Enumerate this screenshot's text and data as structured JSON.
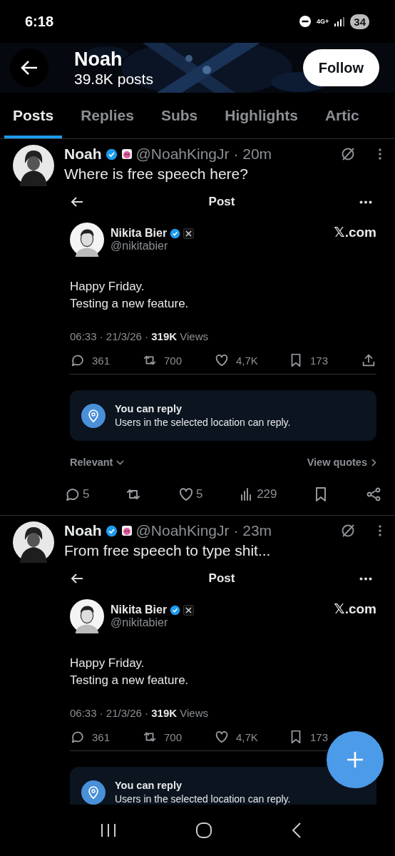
{
  "status_bar": {
    "time": "6:18",
    "network": "4G+",
    "battery": "34"
  },
  "header": {
    "name": "Noah",
    "posts_count": "39.8K posts",
    "follow_button": "Follow"
  },
  "tabs": [
    {
      "label": "Posts",
      "selected": true
    },
    {
      "label": "Replies",
      "selected": false
    },
    {
      "label": "Subs",
      "selected": false
    },
    {
      "label": "Highlights",
      "selected": false
    },
    {
      "label": "Artic",
      "selected": false
    }
  ],
  "posts": [
    {
      "name": "Noah",
      "meta": "@NoahKingJr · 20m",
      "text": "Where is free speech here?",
      "embed": {
        "title": "Post",
        "author": "Nikita Bier",
        "handle": "@nikitabier",
        "site": "𝕏.com",
        "body": "Happy Friday.\nTesting a new feature.",
        "meta": "06:33 · 21/3/26 · **319K** Views",
        "stats": [
          {
            "kind": "reply",
            "count": "361"
          },
          {
            "kind": "repost",
            "count": "700"
          },
          {
            "kind": "like",
            "count": "4,7K"
          },
          {
            "kind": "bookmark",
            "count": "173"
          },
          {
            "kind": "upload"
          }
        ],
        "notice": {
          "title": "You can reply",
          "text": "Users in the selected location can reply."
        },
        "sort": "Relevant",
        "quotes": "View quotes"
      },
      "actions": [
        {
          "kind": "reply",
          "count": "5"
        },
        {
          "kind": "repost"
        },
        {
          "kind": "like",
          "count": "5"
        },
        {
          "kind": "views",
          "count": "229"
        },
        {
          "kind": "bookmark"
        },
        {
          "kind": "share"
        }
      ]
    },
    {
      "name": "Noah",
      "meta": "@NoahKingJr · 23m",
      "text": "From free speech to type shit...",
      "embed": {
        "title": "Post",
        "author": "Nikita Bier",
        "handle": "@nikitabier",
        "site": "𝕏.com",
        "body": "Happy Friday.\nTesting a new feature.",
        "meta": "06:33 · 21/3/26 · **319K** Views",
        "stats": [
          {
            "kind": "reply",
            "count": "361"
          },
          {
            "kind": "repost",
            "count": "700"
          },
          {
            "kind": "like",
            "count": "4,7K"
          },
          {
            "kind": "bookmark",
            "count": "173"
          }
        ],
        "notice": {
          "title": "You can reply",
          "text": "Users in the selected location can reply."
        }
      }
    }
  ]
}
